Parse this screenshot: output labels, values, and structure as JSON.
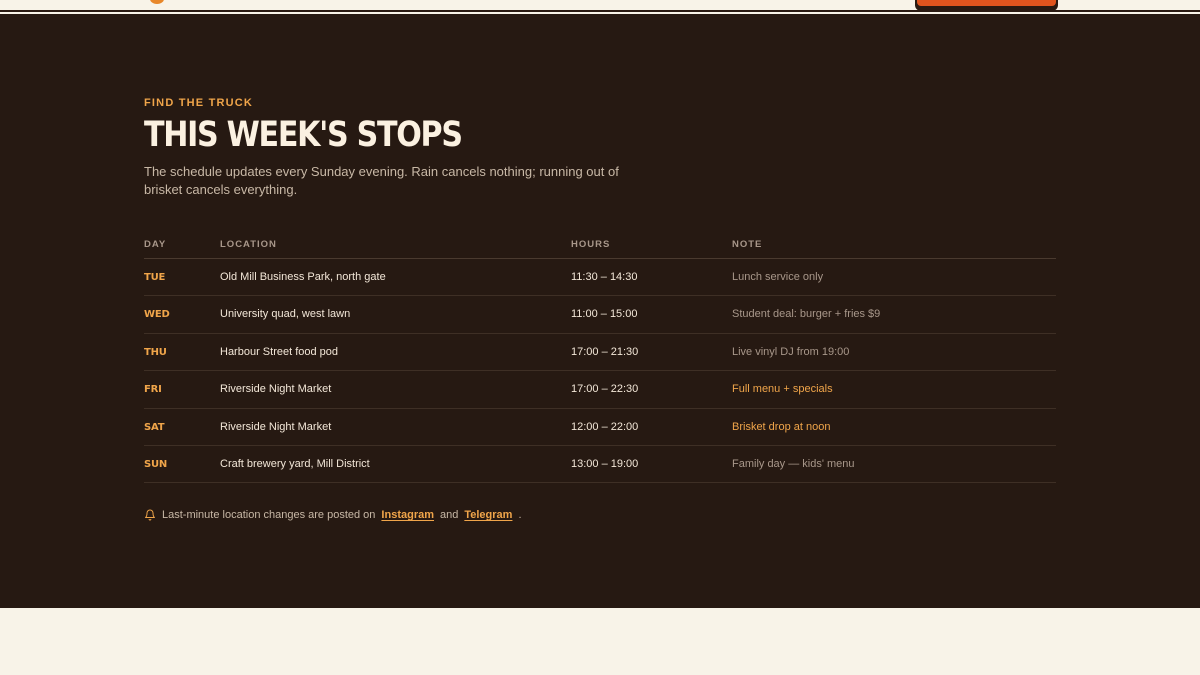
{
  "schedule": {
    "eyebrow": "FIND THE TRUCK",
    "title": "THIS WEEK'S STOPS",
    "lede": "The schedule updates every Sunday evening. Rain cancels nothing; running out of brisket cancels everything.",
    "columns": {
      "day": "DAY",
      "location": "LOCATION",
      "hours": "HOURS",
      "note": "NOTE"
    },
    "rows": [
      {
        "day": "TUE",
        "location": "Old Mill Business Park, north gate",
        "hours": "11:30 – 14:30",
        "note": "Lunch service only"
      },
      {
        "day": "WED",
        "location": "University quad, west lawn",
        "hours": "11:00 – 15:00",
        "note": "Student deal: burger + fries $9"
      },
      {
        "day": "THU",
        "location": "Harbour Street food pod",
        "hours": "17:00 – 21:30",
        "note": "Live vinyl DJ from 19:00"
      },
      {
        "day": "FRI",
        "location": "Riverside Night Market",
        "hours": "17:00 – 22:30",
        "note": "Full menu + specials"
      },
      {
        "day": "SAT",
        "location": "Riverside Night Market",
        "hours": "12:00 – 22:00",
        "note": "Brisket drop at noon"
      },
      {
        "day": "SUN",
        "location": "Craft brewery yard, Mill District",
        "hours": "13:00 – 19:00",
        "note": "Family day — kids' menu"
      }
    ],
    "footnote": {
      "text": "Last-minute location changes are posted on",
      "link1": "Instagram",
      "and": "and",
      "link2": "Telegram",
      "end": "."
    }
  },
  "colors": {
    "accent": "#f0a54a",
    "background": "#261912",
    "cta": "#e0541e",
    "page": "#f8f3e8"
  },
  "icons": {
    "footnote": "bell-icon"
  }
}
